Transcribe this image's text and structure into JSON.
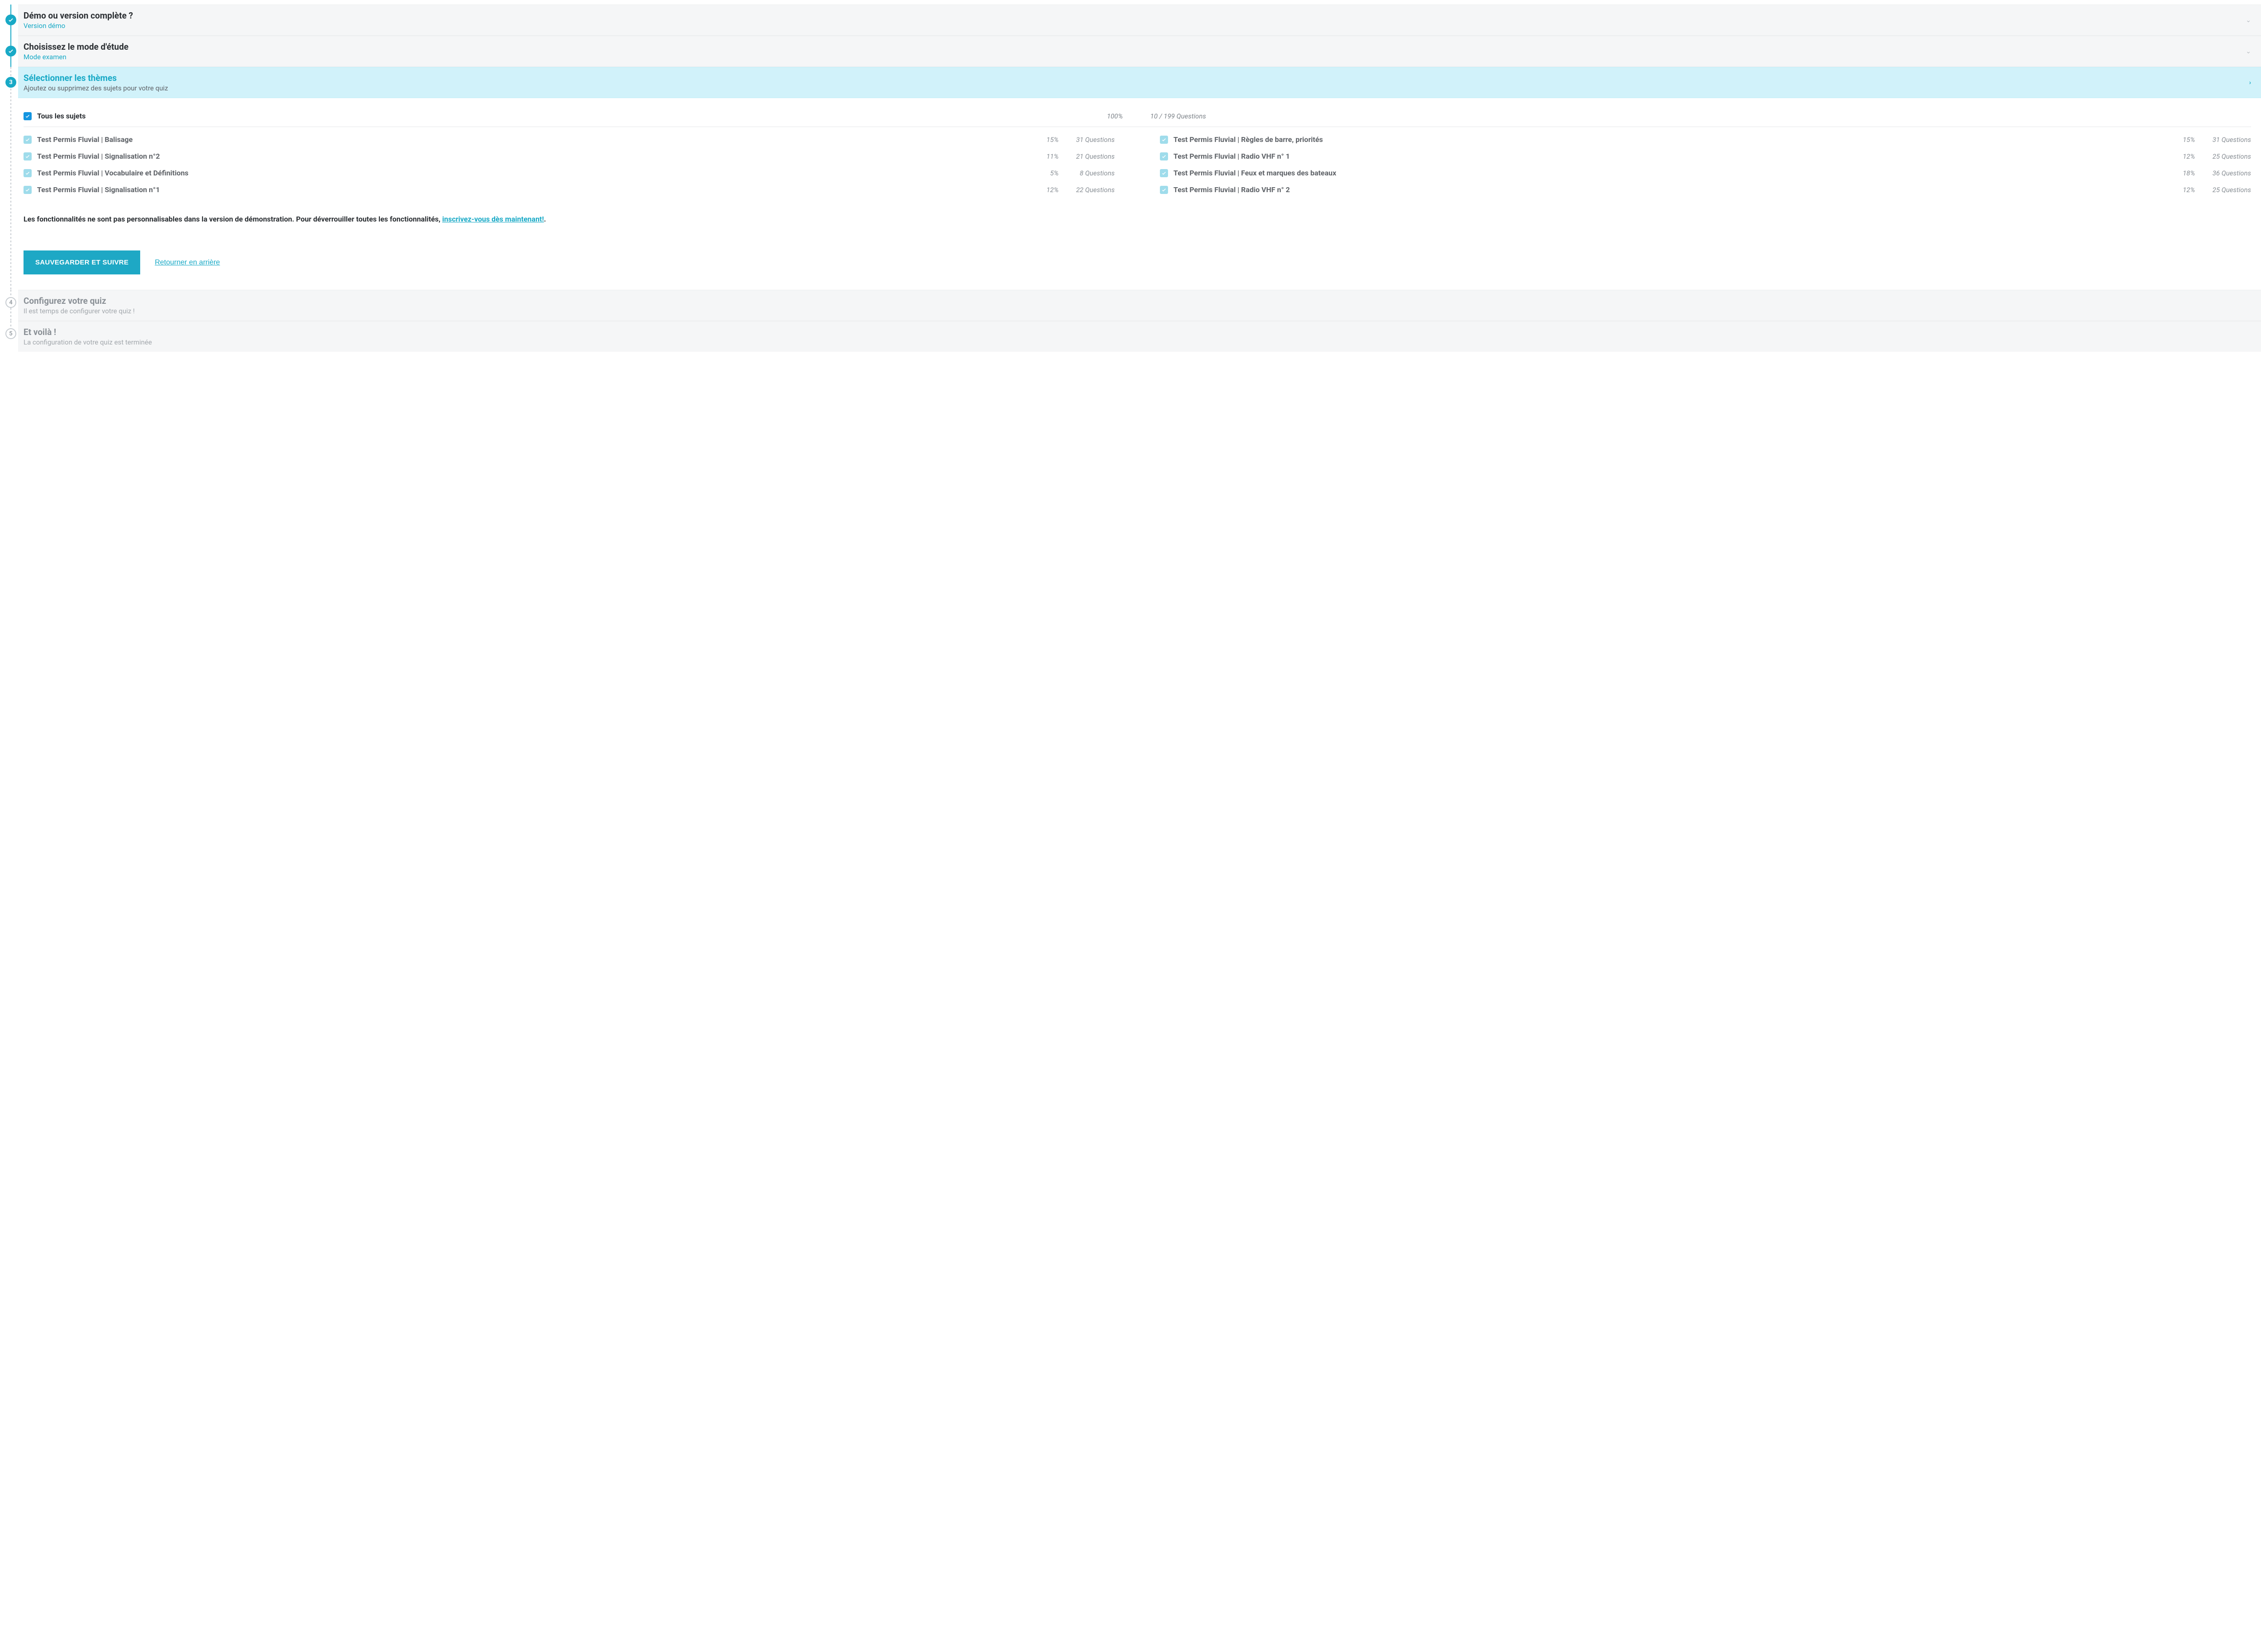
{
  "steps": {
    "s1": {
      "title": "Démo ou version complète ?",
      "sub": "Version démo"
    },
    "s2": {
      "title": "Choisissez le mode d'étude",
      "sub": "Mode examen"
    },
    "s3": {
      "title": "Sélectionner les thèmes",
      "sub": "Ajoutez ou supprimez des sujets pour votre quiz",
      "number": "3"
    },
    "s4": {
      "title": "Configurez votre quiz",
      "sub": "Il est temps de configurer votre quiz !",
      "number": "4"
    },
    "s5": {
      "title": "Et voilà !",
      "sub": "La configuration de votre quiz est terminée",
      "number": "5"
    }
  },
  "all_subjects": {
    "label": "Tous les sujets",
    "pct": "100%",
    "qn": "10 / 199 Questions"
  },
  "subjects_left": [
    {
      "label": "Test Permis Fluvial | Balisage",
      "pct": "15%",
      "qn": "31 Questions"
    },
    {
      "label": "Test Permis Fluvial | Signalisation n°2",
      "pct": "11%",
      "qn": "21 Questions"
    },
    {
      "label": "Test Permis Fluvial | Vocabulaire et Définitions",
      "pct": "5%",
      "qn": "8 Questions"
    },
    {
      "label": "Test Permis Fluvial | Signalisation n°1",
      "pct": "12%",
      "qn": "22 Questions"
    }
  ],
  "subjects_right": [
    {
      "label": "Test Permis Fluvial | Règles de barre, priorités",
      "pct": "15%",
      "qn": "31 Questions"
    },
    {
      "label": "Test Permis Fluvial | Radio VHF n° 1",
      "pct": "12%",
      "qn": "25 Questions"
    },
    {
      "label": "Test Permis Fluvial | Feux et marques des bateaux",
      "pct": "18%",
      "qn": "36 Questions"
    },
    {
      "label": "Test Permis Fluvial | Radio VHF n° 2",
      "pct": "12%",
      "qn": "25 Questions"
    }
  ],
  "demo_note": {
    "text_before": "Les fonctionnalités ne sont pas personnalisables dans la version de démonstration. Pour déverrouiller toutes les fonctionnalités, ",
    "link": "inscrivez-vous dès maintenant!",
    "text_after": "."
  },
  "actions": {
    "save": "SAUVEGARDER ET SUIVRE",
    "back": "Retourner en arrière"
  },
  "icons": {
    "check": "✓",
    "chevron_down": "⌄",
    "chevron_right": "›"
  }
}
